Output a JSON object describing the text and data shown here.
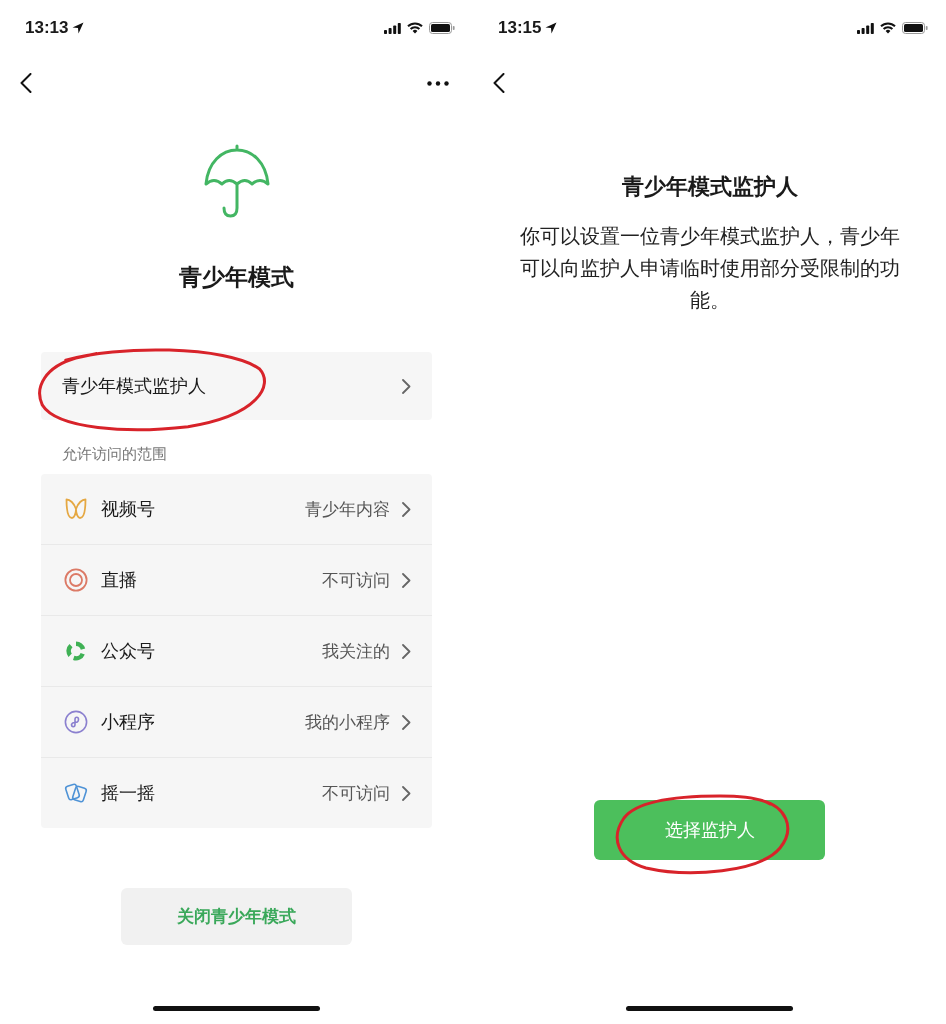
{
  "teen_mode_screen": {
    "status_bar": {
      "time": "13:13"
    },
    "title": "青少年模式",
    "guardian_row": {
      "label": "青少年模式监护人",
      "circled": true
    },
    "section_label": "允许访问的范围",
    "access_items": [
      {
        "label": "视频号",
        "value": "青少年内容"
      },
      {
        "label": "直播",
        "value": "不可访问"
      },
      {
        "label": "公众号",
        "value": "我关注的"
      },
      {
        "label": "小程序",
        "value": "我的小程序"
      },
      {
        "label": "摇一摇",
        "value": "不可访问"
      }
    ],
    "close_button": "关闭青少年模式"
  },
  "guardian_screen": {
    "status_bar": {
      "time": "13:15"
    },
    "title": "青少年模式监护人",
    "description": "你可以设置一位青少年模式监护人，青少年可以向监护人申请临时使用部分受限制的功能。",
    "select_button": {
      "label": "选择监护人",
      "circled": true
    }
  }
}
